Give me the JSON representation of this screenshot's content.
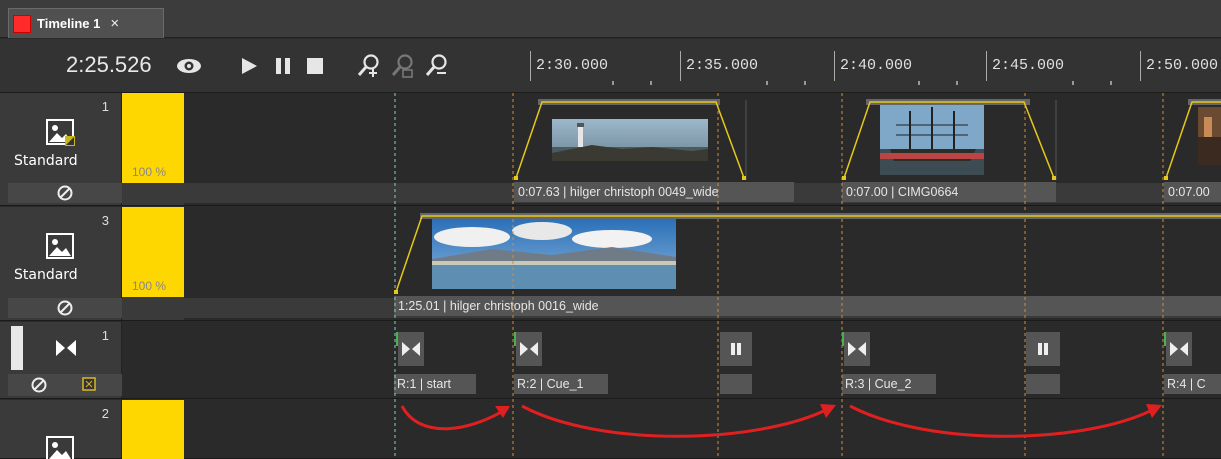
{
  "tab": {
    "title": "Timeline 1",
    "close": "×"
  },
  "toolbar": {
    "time": "2:25.526"
  },
  "ruler": {
    "ticks": [
      "2:30.000",
      "2:35.000",
      "2:40.000",
      "2:45.000",
      "2:50.000"
    ]
  },
  "tracks": [
    {
      "number": "1",
      "label": "Standard",
      "volume": "100 %",
      "volume_level": 1.0,
      "clips": [
        {
          "caption": "0:07.63 | hilger christoph 0049_wide"
        },
        {
          "caption": "0:07.00 | CIMG0664"
        },
        {
          "caption": "0:07.00"
        }
      ]
    },
    {
      "number": "3",
      "label": "Standard",
      "volume": "100 %",
      "volume_level": 1.0,
      "clips": [
        {
          "caption": "1:25.01 | hilger christoph 0016_wide"
        }
      ]
    },
    {
      "number": "1",
      "cues": [
        {
          "caption": "R:1 | start"
        },
        {
          "caption": "R:2 | Cue_1"
        },
        {
          "caption": "R:3 | Cue_2"
        },
        {
          "caption": "R:4 | C"
        }
      ]
    },
    {
      "number": "2"
    }
  ],
  "colors": {
    "accent_yellow": "#ffd700",
    "arrow_red": "#e02020",
    "cue_green": "#4caf50",
    "dash_orange": "#e08a2c",
    "dash_cyan": "#7fd4c8"
  }
}
